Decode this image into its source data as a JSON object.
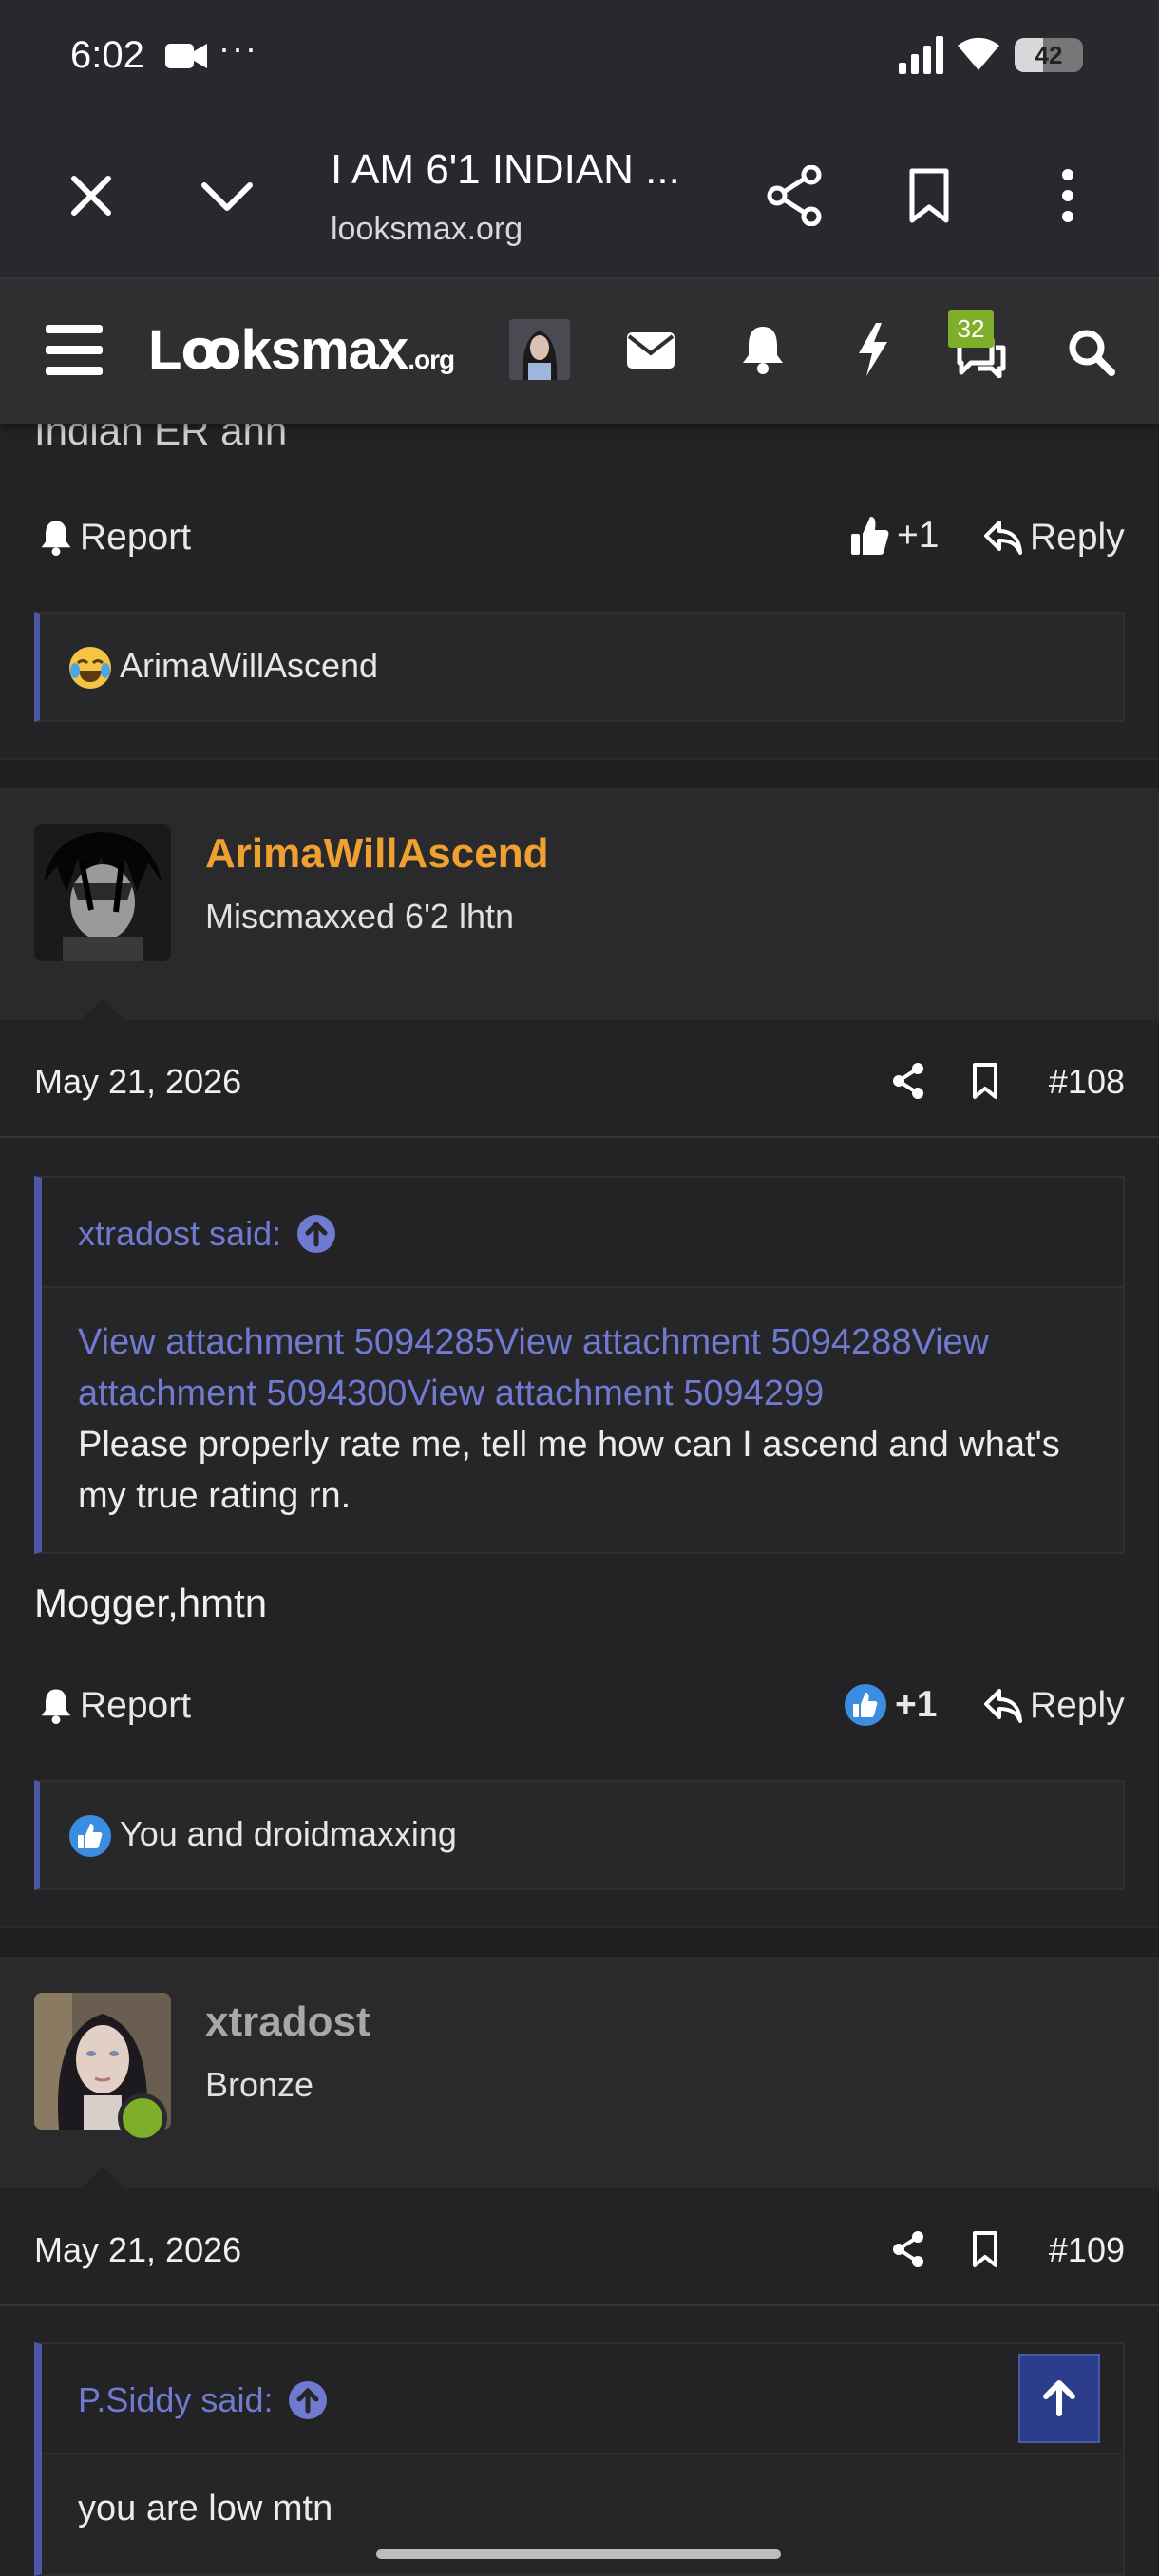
{
  "status_bar": {
    "time": "6:02",
    "more": "···",
    "battery": "42",
    "battery_level": 0.42
  },
  "browser": {
    "title": "I AM 6'1 INDIAN ...",
    "url": "looksmax.org"
  },
  "forum_nav": {
    "logo_main": "Lꝏksmax",
    "logo_suffix": ".org",
    "conversations_badge": "32"
  },
  "posts": [
    {
      "body_tail": "Indian ER ahh",
      "report_label": "Report",
      "like_count": "+1",
      "reply_label": "Reply",
      "reactions_text": "ArimaWillAscend"
    },
    {
      "username": "ArimaWillAscend",
      "username_color": "#f0a030",
      "user_title": "Miscmaxxed 6'2 lhtn",
      "date": "May 21, 2026",
      "number": "#108",
      "quote_author": "xtradost said:",
      "quote_links": "View attachment 5094285View attachment 5094288View attachment 5094300View attachment 5094299",
      "quote_text": "Please properly rate me, tell me how can I ascend and what's my true rating rn.",
      "body": "Mogger,hmtn",
      "report_label": "Report",
      "like_count": "+1",
      "reply_label": "Reply",
      "reactions_text": "You and droidmaxxing"
    },
    {
      "username": "xtradost",
      "username_color": "#a8a8a8",
      "user_title": "Bronze",
      "date": "May 21, 2026",
      "number": "#109",
      "quote_author": "P.Siddy said:",
      "quote_text": "you are low mtn"
    }
  ]
}
